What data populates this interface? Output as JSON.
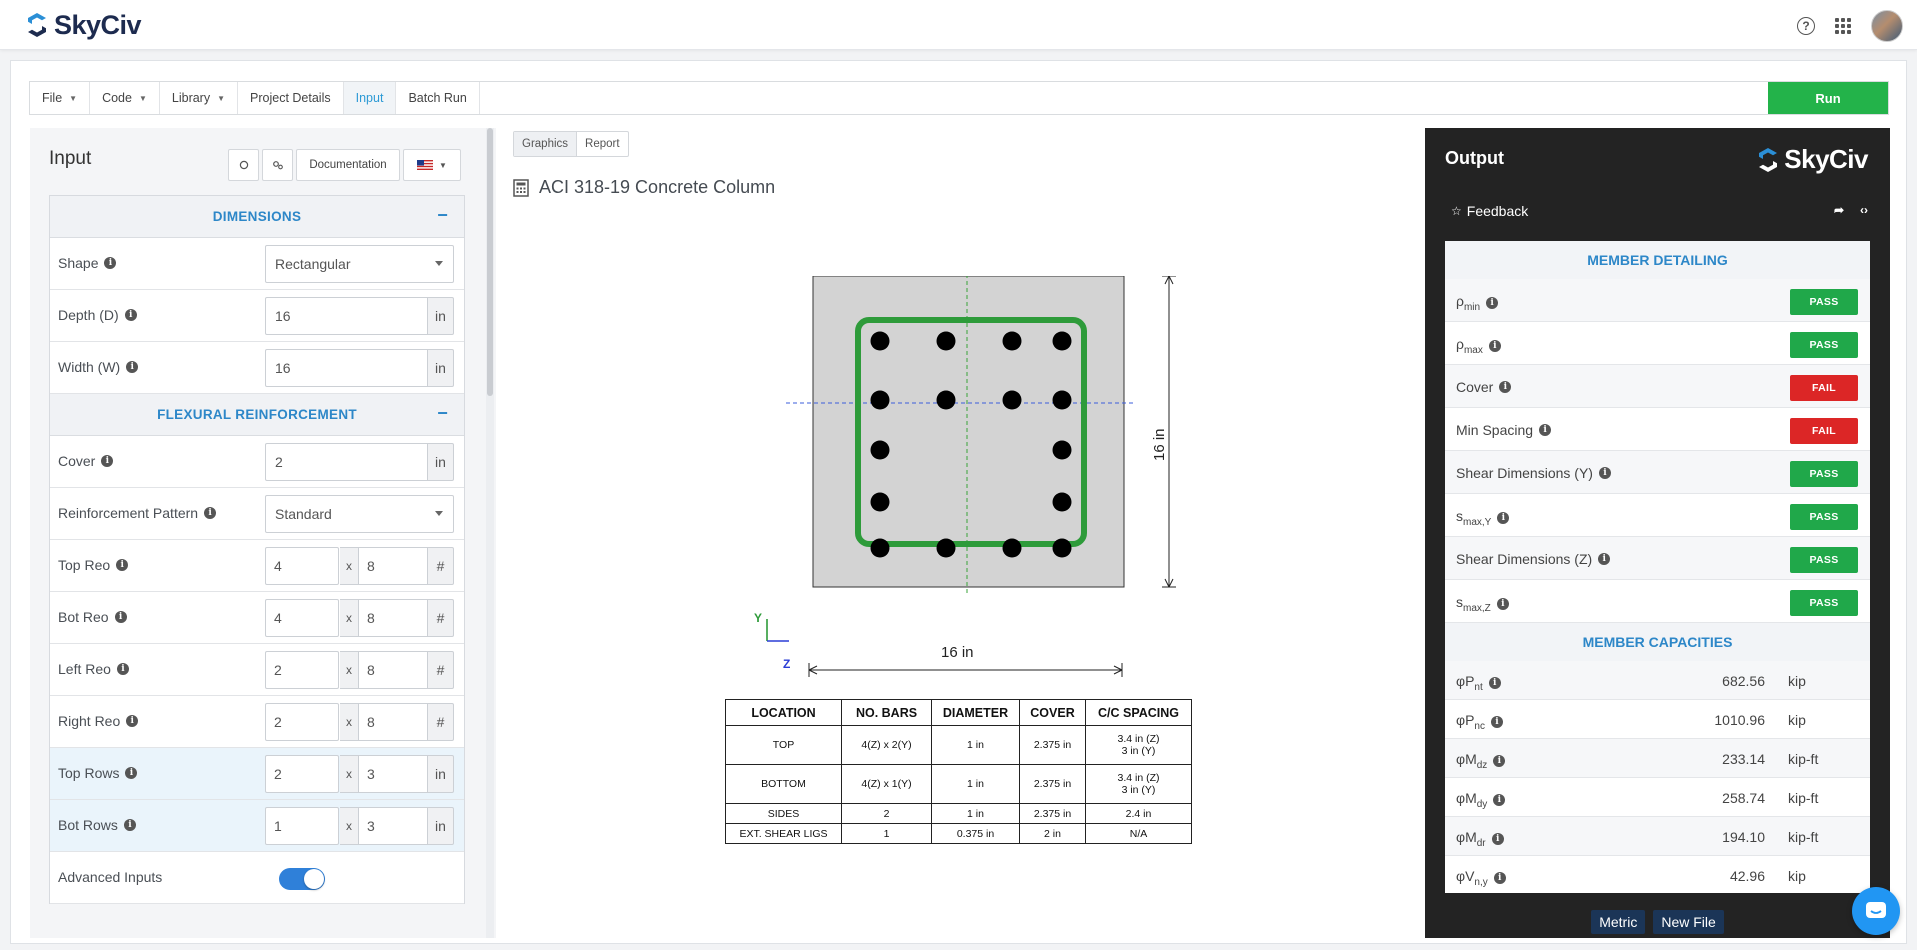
{
  "app": {
    "name": "SkyCiv"
  },
  "menu": {
    "items": [
      {
        "label": "File",
        "caret": true
      },
      {
        "label": "Code",
        "caret": true
      },
      {
        "label": "Library",
        "caret": true
      },
      {
        "label": "Project Details",
        "caret": false
      },
      {
        "label": "Input",
        "caret": false,
        "active": true
      },
      {
        "label": "Batch Run",
        "caret": false
      }
    ],
    "run_label": "Run"
  },
  "input_panel": {
    "title": "Input",
    "documentation_label": "Documentation",
    "sections": {
      "dimensions": {
        "title": "DIMENSIONS",
        "collapse": "−"
      },
      "flexural": {
        "title": "FLEXURAL REINFORCEMENT",
        "collapse": "−"
      }
    },
    "shape": {
      "label": "Shape",
      "value": "Rectangular"
    },
    "depth": {
      "label": "Depth (D)",
      "value": "16",
      "unit": "in"
    },
    "width": {
      "label": "Width (W)",
      "value": "16",
      "unit": "in"
    },
    "cover": {
      "label": "Cover",
      "value": "2",
      "unit": "in"
    },
    "pattern": {
      "label": "Reinforcement Pattern",
      "value": "Standard"
    },
    "top_reo": {
      "label": "Top Reo",
      "count": "4",
      "x": "x",
      "size": "8",
      "unit": "#"
    },
    "bot_reo": {
      "label": "Bot Reo",
      "count": "4",
      "x": "x",
      "size": "8",
      "unit": "#"
    },
    "left_reo": {
      "label": "Left Reo",
      "count": "2",
      "x": "x",
      "size": "8",
      "unit": "#"
    },
    "right_reo": {
      "label": "Right Reo",
      "count": "2",
      "x": "x",
      "size": "8",
      "unit": "#"
    },
    "top_rows": {
      "label": "Top Rows",
      "count": "2",
      "x": "x",
      "size": "3",
      "unit": "in"
    },
    "bot_rows": {
      "label": "Bot Rows",
      "count": "1",
      "x": "x",
      "size": "3",
      "unit": "in"
    },
    "advanced": {
      "label": "Advanced Inputs",
      "enabled": true
    }
  },
  "center": {
    "tabs": [
      "Graphics",
      "Report"
    ],
    "calc_title": "ACI 318-19 Concrete Column",
    "drawing": {
      "width_label": "16 in",
      "depth_label": "16 in",
      "axis_y": "Y",
      "axis_z": "Z"
    },
    "table": {
      "headers": [
        "LOCATION",
        "NO. BARS",
        "DIAMETER",
        "COVER",
        "C/C SPACING"
      ],
      "rows": [
        [
          "TOP",
          "4(Z) x 2(Y)",
          "1 in",
          "2.375 in",
          "3.4 in (Z)",
          "3 in (Y)"
        ],
        [
          "BOTTOM",
          "4(Z) x 1(Y)",
          "1 in",
          "2.375 in",
          "3.4 in (Z)",
          "3 in (Y)"
        ],
        [
          "SIDES",
          "2",
          "1 in",
          "2.375 in",
          "2.4 in",
          ""
        ],
        [
          "EXT. SHEAR LIGS",
          "1",
          "0.375 in",
          "2 in",
          "N/A",
          ""
        ]
      ]
    }
  },
  "output": {
    "title": "Output",
    "feedback_label": "Feedback",
    "member_detailing_title": "MEMBER DETAILING",
    "checks": [
      {
        "sym": "ρ",
        "sub": "min",
        "label": "",
        "status": "PASS"
      },
      {
        "sym": "ρ",
        "sub": "max",
        "label": "",
        "status": "PASS"
      },
      {
        "sym": "",
        "sub": "",
        "label": "Cover",
        "status": "FAIL"
      },
      {
        "sym": "",
        "sub": "",
        "label": "Min Spacing",
        "status": "FAIL"
      },
      {
        "sym": "",
        "sub": "",
        "label": "Shear Dimensions (Y)",
        "status": "PASS"
      },
      {
        "sym": "s",
        "sub": "max,Y",
        "label": "",
        "status": "PASS"
      },
      {
        "sym": "",
        "sub": "",
        "label": "Shear Dimensions (Z)",
        "status": "PASS"
      },
      {
        "sym": "s",
        "sub": "max,Z",
        "label": "",
        "status": "PASS"
      }
    ],
    "member_capacities_title": "MEMBER CAPACITIES",
    "capacities": [
      {
        "sym": "φP",
        "sub": "nt",
        "value": "682.56",
        "unit": "kip"
      },
      {
        "sym": "φP",
        "sub": "nc",
        "value": "1010.96",
        "unit": "kip"
      },
      {
        "sym": "φM",
        "sub": "dz",
        "value": "233.14",
        "unit": "kip-ft"
      },
      {
        "sym": "φM",
        "sub": "dy",
        "value": "258.74",
        "unit": "kip-ft"
      },
      {
        "sym": "φM",
        "sub": "dr",
        "value": "194.10",
        "unit": "kip-ft"
      },
      {
        "sym": "φV",
        "sub": "n,y",
        "value": "42.96",
        "unit": "kip"
      }
    ],
    "footer": {
      "metric_label": "Metric",
      "new_file_label": "New File"
    }
  },
  "colors": {
    "accent": "#2d87c8",
    "pass": "#20a84a",
    "fail": "#dc2626",
    "run": "#23b34a",
    "rebar_ties": "#2e9b3a"
  },
  "icons": [
    "skyciv-logo-icon",
    "help-icon",
    "apps-grid-icon",
    "user-avatar",
    "reset-icon",
    "settings-icon",
    "us-flag-icon",
    "info-icon",
    "calculator-icon",
    "star-icon",
    "share-icon",
    "code-icon",
    "chat-icon"
  ]
}
